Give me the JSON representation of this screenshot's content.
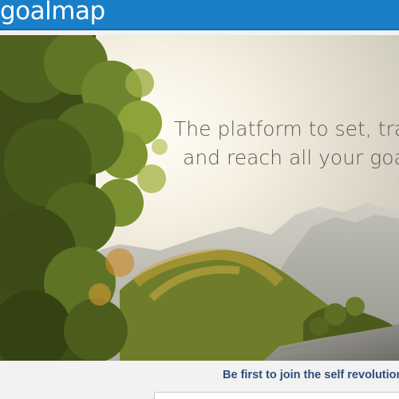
{
  "header": {
    "logo_text": "goalmap",
    "brand_color": "#1a7fc9"
  },
  "hero": {
    "tagline_line1": "The platform to set, track",
    "tagline_line2": "and reach all your goals.",
    "image_description_icon": "landscape-photo"
  },
  "signup": {
    "heading": "Be first to join the self revolution",
    "email_placeholder": ""
  }
}
